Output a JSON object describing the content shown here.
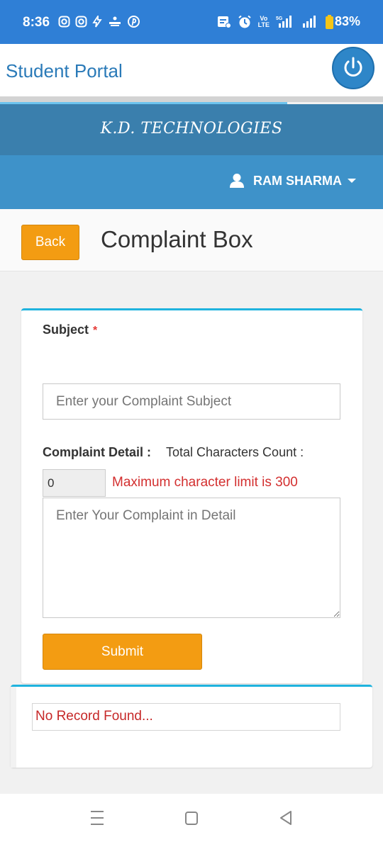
{
  "status_bar": {
    "time": "8:36",
    "network": "5G",
    "lte_top": "Vo",
    "lte_bottom": "LTE",
    "battery": "83%"
  },
  "header": {
    "title": "Student Portal"
  },
  "brand": {
    "name": "K.D. TECHNOLOGIES"
  },
  "user": {
    "name": "RAM SHARMA"
  },
  "page": {
    "back_label": "Back",
    "title": "Complaint Box"
  },
  "form": {
    "subject_label": "Subject",
    "required_mark": "*",
    "subject_placeholder": "Enter your Complaint Subject",
    "detail_label": "Complaint Detail :",
    "count_label": "Total Characters Count :",
    "count_value": "0",
    "limit_message": "Maximum character limit is 300",
    "detail_placeholder": "Enter Your Complaint in Detail",
    "submit_label": "Submit"
  },
  "results": {
    "message": "No Record Found..."
  },
  "colors": {
    "status": "#2f7fd6",
    "brand_bar": "#3a7fad",
    "user_bar": "#3e92c9",
    "accent": "#f39c12",
    "card_top": "#1fb3de"
  },
  "icons": {
    "power": "power-icon",
    "user": "user-icon",
    "nav_recents": "recents-icon",
    "nav_home": "home-icon",
    "nav_back": "back-triangle-icon"
  }
}
